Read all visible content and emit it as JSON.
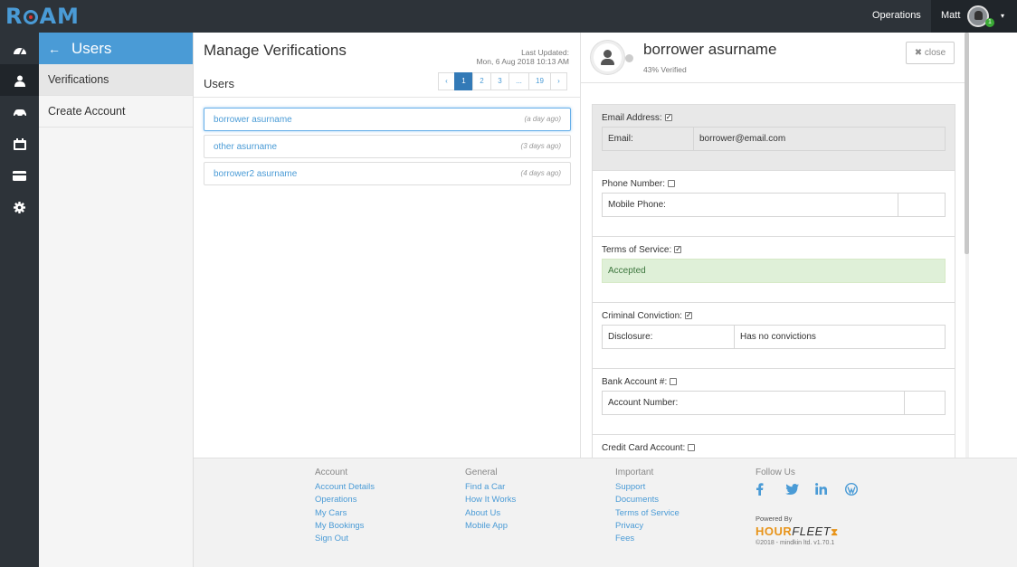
{
  "topbar": {
    "logo": "ROAM",
    "nav_operations": "Operations",
    "user_name": "Matt",
    "notification_count": "1",
    "caret": "▾"
  },
  "iconbar": [
    "dashboard-icon",
    "user-icon",
    "car-icon",
    "calendar-icon",
    "credit-card-icon",
    "gear-icon"
  ],
  "sidebar": {
    "back_arrow": "←",
    "title": "Users",
    "items": [
      {
        "label": "Verifications",
        "active": true
      },
      {
        "label": "Create Account",
        "active": false
      }
    ]
  },
  "middle": {
    "title": "Manage Verifications",
    "last_updated_label": "Last Updated:",
    "last_updated_value": "Mon, 6 Aug 2018 10:13 AM",
    "users_label": "Users",
    "pager": [
      "‹",
      "1",
      "2",
      "3",
      "...",
      "19",
      "›"
    ],
    "pager_active": "1",
    "users": [
      {
        "name": "borrower asurname",
        "ago": "(a day ago)",
        "active": true
      },
      {
        "name": "other asurname",
        "ago": "(3 days ago)",
        "active": false
      },
      {
        "name": "borrower2 asurname",
        "ago": "(4 days ago)",
        "active": false
      }
    ]
  },
  "detail": {
    "name": "borrower asurname",
    "verified_pct": "43% Verified",
    "close_label": "✖ close",
    "email": {
      "label": "Email Address:",
      "checked": true,
      "key": "Email:",
      "value": "borrower@email.com"
    },
    "phone": {
      "label": "Phone Number:",
      "checked": false,
      "key": "Mobile Phone:",
      "value": ""
    },
    "tos": {
      "label": "Terms of Service:",
      "checked": true,
      "value": "Accepted"
    },
    "criminal": {
      "label": "Criminal Conviction:",
      "checked": true,
      "key": "Disclosure:",
      "value": "Has no convictions"
    },
    "bank": {
      "label": "Bank Account #:",
      "checked": false,
      "key": "Account Number:",
      "value": ""
    },
    "card": {
      "label": "Credit Card Account:",
      "checked": false
    }
  },
  "footer": {
    "account": {
      "heading": "Account",
      "links": [
        "Account Details",
        "Operations",
        "My Cars",
        "My Bookings",
        "Sign Out"
      ]
    },
    "general": {
      "heading": "General",
      "links": [
        "Find a Car",
        "How It Works",
        "About Us",
        "Mobile App"
      ]
    },
    "important": {
      "heading": "Important",
      "links": [
        "Support",
        "Documents",
        "Terms of Service",
        "Privacy",
        "Fees"
      ]
    },
    "follow": {
      "heading": "Follow Us",
      "icons": [
        "facebook-icon",
        "twitter-icon",
        "linkedin-icon",
        "wordpress-icon"
      ]
    },
    "powered_by": "Powered By",
    "brand_hour": "HOUR",
    "brand_fleet": "FLEET",
    "copyright": "©2018 - mindkin ltd. v1.70.1"
  },
  "colors": {
    "accent": "#4a9bd6",
    "topbar": "#2d3339",
    "success_bg": "#dff0d8",
    "brand_orange": "#e8941a"
  }
}
